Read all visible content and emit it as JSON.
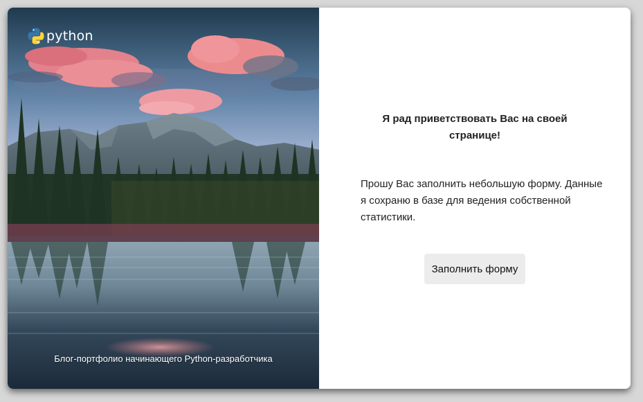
{
  "hero": {
    "logo_text": "python",
    "caption": "Блог-портфолио начинающего Python-разработчика"
  },
  "panel": {
    "greeting": "Я рад приветствовать Вас на своей странице!",
    "message": "Прошу Вас заполнить небольшую форму. Данные я сохраню в базе для ведения собственной статистики.",
    "button_label": "Заполнить форму"
  },
  "colors": {
    "python_blue": "#3776ab",
    "python_yellow": "#ffd43b",
    "button_bg": "#ececec"
  }
}
